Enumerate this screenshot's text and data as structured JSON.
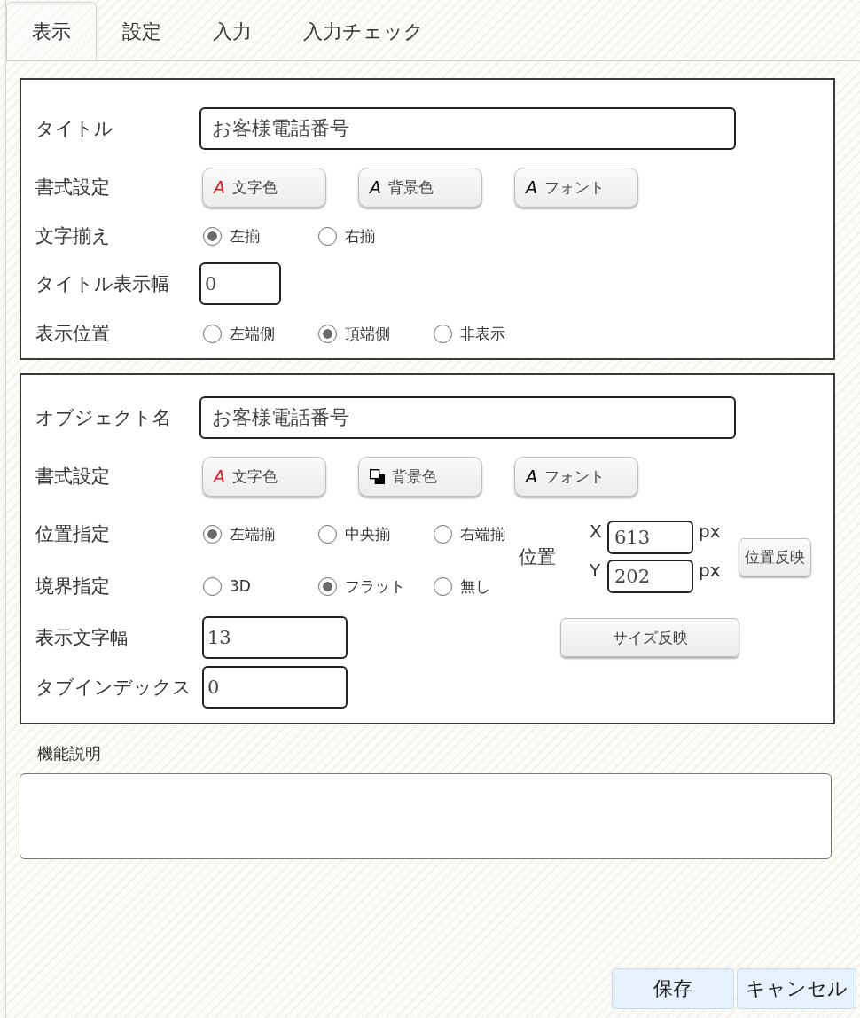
{
  "tabs": [
    {
      "label": "表示",
      "selected": true
    },
    {
      "label": "設定",
      "selected": false
    },
    {
      "label": "入力",
      "selected": false
    },
    {
      "label": "入力チェック",
      "selected": false
    }
  ],
  "panels": [
    {
      "rows": [
        {
          "kind": "text",
          "label": "タイトル",
          "value": "お客様電話番号"
        },
        {
          "kind": "buttons",
          "label": "書式設定",
          "buttons": [
            {
              "kind": "glyph",
              "glyph": "A",
              "color": "#e8141c",
              "label": "文字色"
            },
            {
              "kind": "glyph",
              "glyph": "A",
              "color": "#000000",
              "label": "背景色"
            },
            {
              "kind": "glyph",
              "glyph": "A",
              "color": "#000000",
              "label": "フォント"
            }
          ]
        },
        {
          "kind": "radio",
          "label": "文字揃え",
          "options": [
            {
              "label": "左揃",
              "selected": true
            },
            {
              "label": "右揃",
              "selected": false
            }
          ]
        },
        {
          "kind": "number",
          "label": "タイトル表示幅",
          "value": "0"
        },
        {
          "kind": "radio",
          "label": "表示位置",
          "options": [
            {
              "label": "左端側",
              "selected": false
            },
            {
              "label": "頂端側",
              "selected": true
            },
            {
              "label": "非表示",
              "selected": false
            }
          ]
        }
      ]
    },
    {
      "rows": [
        {
          "kind": "text",
          "label": "オブジェクト名",
          "value": "お客様電話番号"
        },
        {
          "kind": "buttons",
          "label": "書式設定",
          "buttons": [
            {
              "kind": "glyph",
              "glyph": "A",
              "color": "#e8141c",
              "label": "文字色"
            },
            {
              "kind": "swatch",
              "label": "背景色"
            },
            {
              "kind": "glyph",
              "glyph": "A",
              "color": "#000000",
              "label": "フォント"
            }
          ]
        },
        {
          "kind": "radio",
          "label": "位置指定",
          "options": [
            {
              "label": "左端揃",
              "selected": true
            },
            {
              "label": "中央揃",
              "selected": false
            },
            {
              "label": "右端揃",
              "selected": false
            }
          ]
        },
        {
          "kind": "radio",
          "label": "境界指定",
          "options": [
            {
              "label": "3D",
              "selected": false
            },
            {
              "label": "フラット",
              "selected": true
            },
            {
              "label": "無し",
              "selected": false
            }
          ]
        },
        {
          "kind": "number",
          "label": "表示文字幅",
          "value": "13"
        },
        {
          "kind": "number",
          "label": "タブインデックス",
          "value": "0"
        }
      ],
      "position": {
        "label": "位置",
        "fields": [
          {
            "axis": "X",
            "value": "613",
            "unit": "px"
          },
          {
            "axis": "Y",
            "value": "202",
            "unit": "px"
          }
        ],
        "button": "位置反映"
      },
      "size_button": "サイズ反映"
    }
  ],
  "description": {
    "label": "機能説明"
  },
  "buttons": [
    "保存",
    "キャンセル"
  ]
}
